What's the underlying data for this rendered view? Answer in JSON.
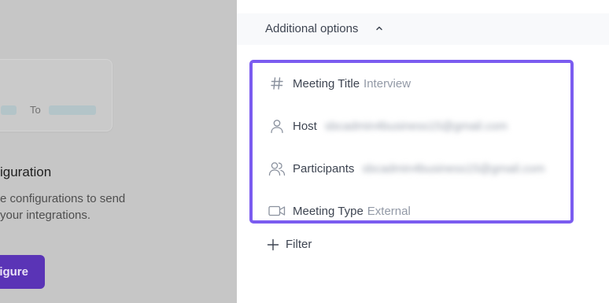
{
  "left_panel": {
    "flow_card": {
      "to_label": "To"
    },
    "config_title": "iguration",
    "config_desc_line1": "e configurations to send",
    "config_desc_line2": "your integrations.",
    "configure_button_label": "igure"
  },
  "additional_options": {
    "header_label": "Additional options",
    "filters": [
      {
        "icon": "hash-icon",
        "label": "Meeting Title",
        "value": "Interview",
        "blurred": false
      },
      {
        "icon": "user-icon",
        "label": "Host",
        "value": "sbcadmin4business15@gmail.com",
        "blurred": true
      },
      {
        "icon": "users-icon",
        "label": "Participants",
        "value": "sbcadmin4business15@gmail.com",
        "blurred": true
      },
      {
        "icon": "video-camera-icon",
        "label": "Meeting Type",
        "value": "External",
        "blurred": false
      }
    ],
    "add_filter_label": "Filter"
  },
  "colors": {
    "accent_border": "#7b5cf0",
    "configure_button": "#5a34b6",
    "overlay": "#c6c6c6"
  }
}
